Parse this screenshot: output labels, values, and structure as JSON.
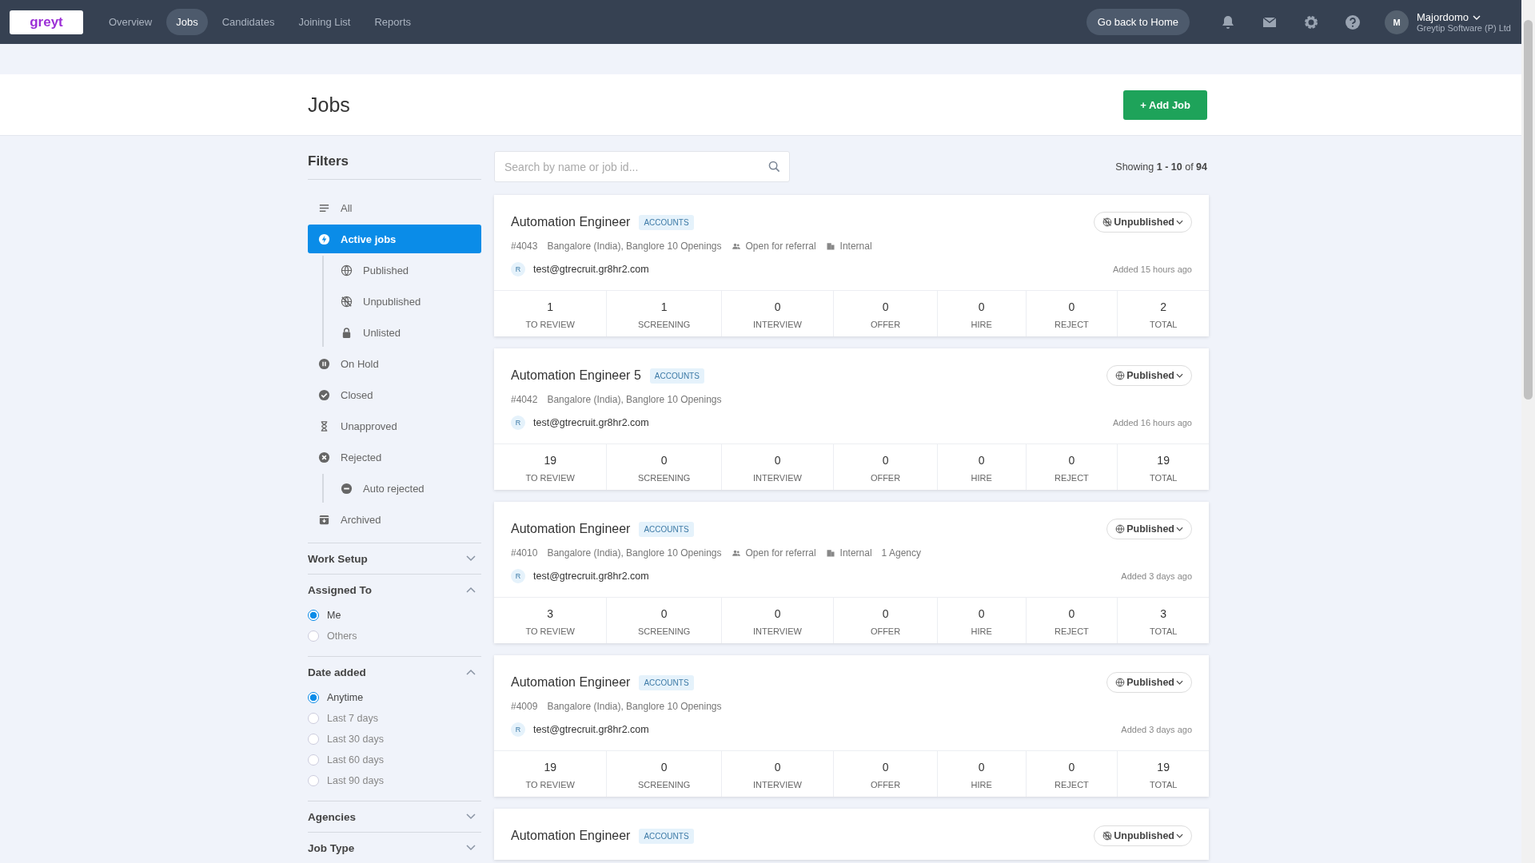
{
  "nav": {
    "logo": "greyt",
    "tabs": [
      {
        "label": "Overview",
        "selected": false
      },
      {
        "label": "Jobs",
        "selected": true
      },
      {
        "label": "Candidates",
        "selected": false
      },
      {
        "label": "Joining List",
        "selected": false
      },
      {
        "label": "Reports",
        "selected": false
      }
    ],
    "home_button": "Go back to Home",
    "user": {
      "initial": "M",
      "name": "Majordomo",
      "company": "Greytip Software (P) Ltd"
    }
  },
  "header": {
    "title": "Jobs",
    "add_button": "+ Add Job"
  },
  "filters": {
    "title": "Filters",
    "items": [
      {
        "kind": "all",
        "label": "All",
        "selected": false
      },
      {
        "kind": "active",
        "label": "Active jobs",
        "selected": true,
        "children": [
          {
            "kind": "published",
            "label": "Published",
            "selected": false
          },
          {
            "kind": "unpublished",
            "label": "Unpublished",
            "selected": false
          },
          {
            "kind": "unlisted",
            "label": "Unlisted",
            "selected": false
          }
        ]
      },
      {
        "kind": "hold",
        "label": "On Hold",
        "selected": false
      },
      {
        "kind": "closed",
        "label": "Closed",
        "selected": false
      },
      {
        "kind": "unapproved",
        "label": "Unapproved",
        "selected": false
      },
      {
        "kind": "rejected",
        "label": "Rejected",
        "selected": false,
        "children": [
          {
            "kind": "auto",
            "label": "Auto rejected",
            "selected": false
          }
        ]
      },
      {
        "kind": "archived",
        "label": "Archived",
        "selected": false
      }
    ],
    "sections": [
      {
        "title": "Work Setup",
        "expanded": false
      },
      {
        "title": "Assigned To",
        "expanded": true,
        "options": [
          {
            "label": "Me",
            "selected": true
          },
          {
            "label": "Others",
            "selected": false
          }
        ]
      },
      {
        "title": "Date added",
        "expanded": true,
        "options": [
          {
            "label": "Anytime",
            "selected": true
          },
          {
            "label": "Last 7 days",
            "selected": false
          },
          {
            "label": "Last 30 days",
            "selected": false
          },
          {
            "label": "Last 60 days",
            "selected": false
          },
          {
            "label": "Last 90 days",
            "selected": false
          }
        ]
      },
      {
        "title": "Agencies",
        "expanded": false
      },
      {
        "title": "Job Type",
        "expanded": false
      }
    ]
  },
  "search": {
    "placeholder": "Search by name or job id..."
  },
  "showing": "Showing **1 - 10** of **94**",
  "jobs": [
    {
      "title": "Automation Engineer",
      "tag": "ACCOUNTS",
      "status": {
        "kind": "unpublished",
        "label": "Unpublished"
      },
      "meta": [
        {
          "kind": "text",
          "text": "#4043"
        },
        {
          "kind": "text",
          "text": "Bangalore (India), Banglore 10 Openings"
        },
        {
          "kind": "referral",
          "text": "Open for referral"
        },
        {
          "kind": "internal",
          "text": "Internal"
        }
      ],
      "recruiter_initial": "R",
      "email": "test@gtrecruit.gr8hr2.com",
      "added": "Added 15 hours ago",
      "stats": [
        {
          "value": "1",
          "label": "TO REVIEW"
        },
        {
          "value": "1",
          "label": "SCREENING"
        },
        {
          "value": "0",
          "label": "INTERVIEW"
        },
        {
          "value": "0",
          "label": "OFFER"
        },
        {
          "value": "0",
          "label": "HIRE"
        },
        {
          "value": "0",
          "label": "REJECT"
        },
        {
          "value": "2",
          "label": "TOTAL"
        }
      ]
    },
    {
      "title": "Automation Engineer 5",
      "tag": "ACCOUNTS",
      "status": {
        "kind": "published",
        "label": "Published"
      },
      "meta": [
        {
          "kind": "text",
          "text": "#4042"
        },
        {
          "kind": "text",
          "text": "Bangalore (India), Banglore 10 Openings"
        }
      ],
      "recruiter_initial": "R",
      "email": "test@gtrecruit.gr8hr2.com",
      "added": "Added 16 hours ago",
      "stats": [
        {
          "value": "19",
          "label": "TO REVIEW"
        },
        {
          "value": "0",
          "label": "SCREENING"
        },
        {
          "value": "0",
          "label": "INTERVIEW"
        },
        {
          "value": "0",
          "label": "OFFER"
        },
        {
          "value": "0",
          "label": "HIRE"
        },
        {
          "value": "0",
          "label": "REJECT"
        },
        {
          "value": "19",
          "label": "TOTAL"
        }
      ]
    },
    {
      "title": "Automation Engineer",
      "tag": "ACCOUNTS",
      "status": {
        "kind": "published",
        "label": "Published"
      },
      "meta": [
        {
          "kind": "text",
          "text": "#4010"
        },
        {
          "kind": "text",
          "text": "Bangalore (India), Banglore 10 Openings"
        },
        {
          "kind": "referral",
          "text": "Open for referral"
        },
        {
          "kind": "internal",
          "text": "Internal"
        },
        {
          "kind": "text",
          "text": "1  Agency"
        }
      ],
      "recruiter_initial": "R",
      "email": "test@gtrecruit.gr8hr2.com",
      "added": "Added 3 days ago",
      "stats": [
        {
          "value": "3",
          "label": "TO REVIEW"
        },
        {
          "value": "0",
          "label": "SCREENING"
        },
        {
          "value": "0",
          "label": "INTERVIEW"
        },
        {
          "value": "0",
          "label": "OFFER"
        },
        {
          "value": "0",
          "label": "HIRE"
        },
        {
          "value": "0",
          "label": "REJECT"
        },
        {
          "value": "3",
          "label": "TOTAL"
        }
      ]
    },
    {
      "title": "Automation Engineer",
      "tag": "ACCOUNTS",
      "status": {
        "kind": "published",
        "label": "Published"
      },
      "meta": [
        {
          "kind": "text",
          "text": "#4009"
        },
        {
          "kind": "text",
          "text": "Bangalore (India), Banglore 10 Openings"
        }
      ],
      "recruiter_initial": "R",
      "email": "test@gtrecruit.gr8hr2.com",
      "added": "Added 3 days ago",
      "stats": [
        {
          "value": "19",
          "label": "TO REVIEW"
        },
        {
          "value": "0",
          "label": "SCREENING"
        },
        {
          "value": "0",
          "label": "INTERVIEW"
        },
        {
          "value": "0",
          "label": "OFFER"
        },
        {
          "value": "0",
          "label": "HIRE"
        },
        {
          "value": "0",
          "label": "REJECT"
        },
        {
          "value": "19",
          "label": "TOTAL"
        }
      ]
    },
    {
      "title": "Automation Engineer",
      "tag": "ACCOUNTS",
      "status": {
        "kind": "unpublished",
        "label": "Unpublished"
      }
    }
  ]
}
